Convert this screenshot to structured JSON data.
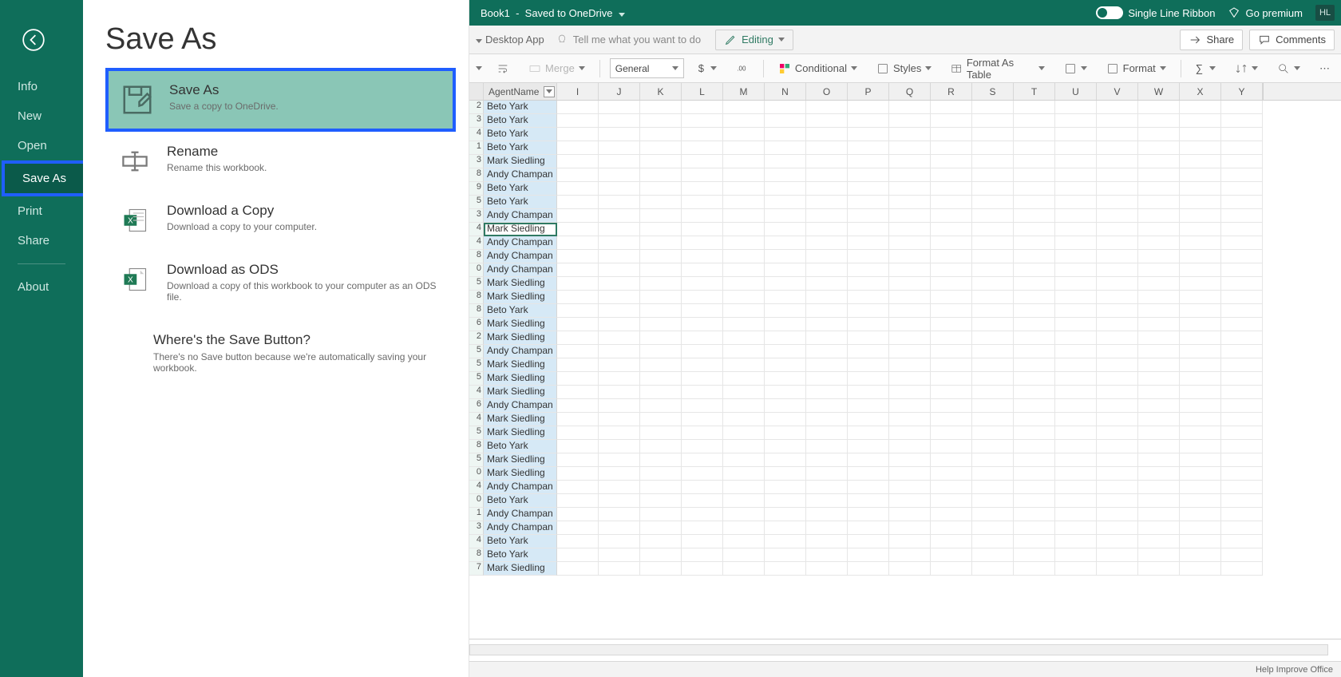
{
  "sidebar": {
    "items": [
      "Info",
      "New",
      "Open",
      "Save As",
      "Print",
      "Share",
      "About"
    ],
    "active_index": 3
  },
  "panel": {
    "title": "Save As",
    "options": [
      {
        "title": "Save As",
        "desc": "Save a copy to OneDrive."
      },
      {
        "title": "Rename",
        "desc": "Rename this workbook."
      },
      {
        "title": "Download a Copy",
        "desc": "Download a copy to your computer."
      },
      {
        "title": "Download as ODS",
        "desc": "Download a copy of this workbook to your computer as an ODS file."
      }
    ],
    "info": {
      "title": "Where's the Save Button?",
      "desc": "There's no Save button because we're automatically saving your workbook."
    }
  },
  "titlebar": {
    "doc": "Book1",
    "status": "Saved to OneDrive",
    "single_line": "Single Line Ribbon",
    "premium": "Go premium",
    "user": "HL"
  },
  "tabrow": {
    "left_cut": "Desktop App",
    "tellme": "Tell me what you want to do",
    "editing": "Editing",
    "share": "Share",
    "comments": "Comments"
  },
  "ribbon": {
    "merge": "Merge",
    "numfmt": "General",
    "conditional": "Conditional",
    "styles": "Styles",
    "format_table": "Format As Table",
    "format": "Format"
  },
  "grid": {
    "col_agent": "AgentName",
    "cols": [
      "I",
      "J",
      "K",
      "L",
      "M",
      "N",
      "O",
      "P",
      "Q",
      "R",
      "S",
      "T",
      "U",
      "V",
      "W",
      "X",
      "Y"
    ],
    "rows": [
      {
        "n": "2",
        "agent": "Beto Yark"
      },
      {
        "n": "3",
        "agent": "Beto Yark"
      },
      {
        "n": "4",
        "agent": "Beto Yark"
      },
      {
        "n": "1",
        "agent": "Beto Yark"
      },
      {
        "n": "3",
        "agent": "Mark Siedling"
      },
      {
        "n": "8",
        "agent": "Andy Champan"
      },
      {
        "n": "9",
        "agent": "Beto Yark"
      },
      {
        "n": "5",
        "agent": "Beto Yark"
      },
      {
        "n": "3",
        "agent": "Andy Champan"
      },
      {
        "n": "4",
        "agent": "Mark Siedling",
        "sel": true
      },
      {
        "n": "4",
        "agent": "Andy Champan"
      },
      {
        "n": "8",
        "agent": "Andy Champan"
      },
      {
        "n": "0",
        "agent": "Andy Champan"
      },
      {
        "n": "5",
        "agent": "Mark Siedling"
      },
      {
        "n": "8",
        "agent": "Mark Siedling"
      },
      {
        "n": "8",
        "agent": "Beto Yark"
      },
      {
        "n": "6",
        "agent": "Mark Siedling"
      },
      {
        "n": "2",
        "agent": "Mark Siedling"
      },
      {
        "n": "5",
        "agent": "Andy Champan"
      },
      {
        "n": "5",
        "agent": "Mark Siedling"
      },
      {
        "n": "5",
        "agent": "Mark Siedling"
      },
      {
        "n": "4",
        "agent": "Mark Siedling"
      },
      {
        "n": "6",
        "agent": "Andy Champan"
      },
      {
        "n": "4",
        "agent": "Mark Siedling"
      },
      {
        "n": "5",
        "agent": "Mark Siedling"
      },
      {
        "n": "8",
        "agent": "Beto Yark"
      },
      {
        "n": "5",
        "agent": "Mark Siedling"
      },
      {
        "n": "0",
        "agent": "Mark Siedling"
      },
      {
        "n": "4",
        "agent": "Andy Champan"
      },
      {
        "n": "0",
        "agent": "Beto Yark"
      },
      {
        "n": "1",
        "agent": "Andy Champan"
      },
      {
        "n": "3",
        "agent": "Andy Champan"
      },
      {
        "n": "4",
        "agent": "Beto Yark"
      },
      {
        "n": "8",
        "agent": "Beto Yark"
      },
      {
        "n": "7",
        "agent": "Mark Siedling"
      }
    ]
  },
  "status": {
    "help": "Help Improve Office"
  }
}
